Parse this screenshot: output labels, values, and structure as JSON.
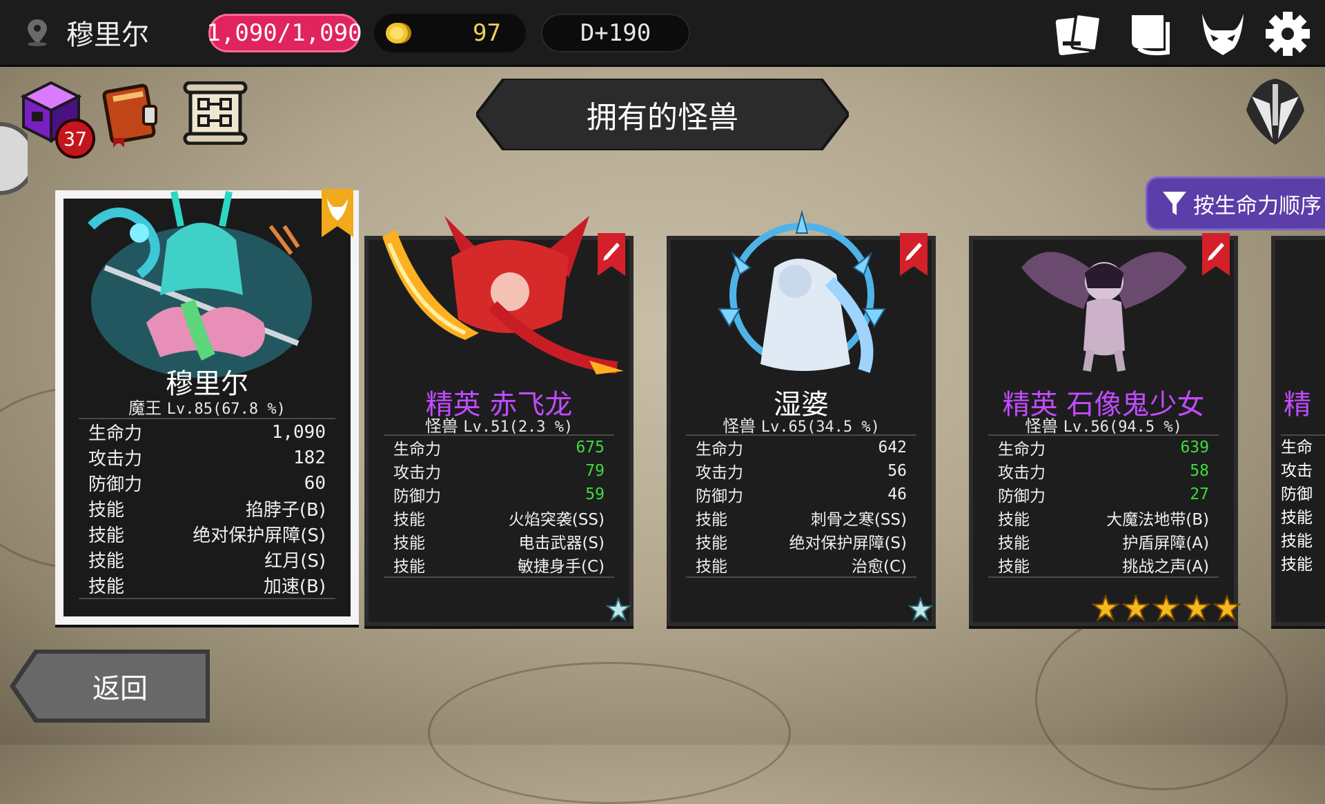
{
  "player": {
    "name": "穆里尔"
  },
  "resources": {
    "hp": "1,090/1,090",
    "coins": "97",
    "day": "D+190"
  },
  "cube_badge": "37",
  "title": "拥有的怪兽",
  "sort_label": "按生命力顺序",
  "back_label": "返回",
  "stat_labels": {
    "hp": "生命力",
    "atk": "攻击力",
    "def": "防御力",
    "skill": "技能"
  },
  "cards": [
    {
      "name": "穆里尔",
      "elite_prefix": "",
      "class": "魔王",
      "level": "Lv.85(67.8 %)",
      "hp": "1,090",
      "atk": "182",
      "def": "60",
      "skills": [
        "掐脖子(B)",
        "绝对保护屏障(S)",
        "红月(S)",
        "加速(B)"
      ],
      "bookmark": "demon-crest",
      "stars": 0,
      "color": "#f2a91c"
    },
    {
      "name": "赤飞龙",
      "elite_prefix": "精英",
      "class": "怪兽",
      "level": "Lv.51(2.3 %)",
      "hp": "675",
      "atk": "79",
      "def": "59",
      "skills": [
        "火焰突袭(SS)",
        "电击武器(S)",
        "敏捷身手(C)"
      ],
      "bookmark": "edit-pencil",
      "stars": 1
    },
    {
      "name": "湿婆",
      "elite_prefix": "",
      "class": "怪兽",
      "level": "Lv.65(34.5 %)",
      "hp": "642",
      "atk": "56",
      "def": "46",
      "skills": [
        "刺骨之寒(SS)",
        "绝对保护屏障(S)",
        "治愈(C)"
      ],
      "bookmark": "edit-pencil",
      "stars": 1
    },
    {
      "name": "石像鬼少女",
      "elite_prefix": "精英",
      "class": "怪兽",
      "level": "Lv.56(94.5 %)",
      "hp": "639",
      "atk": "58",
      "def": "27",
      "skills": [
        "大魔法地带(B)",
        "护盾屏障(A)",
        "挑战之声(A)"
      ],
      "bookmark": "edit-pencil",
      "stars": 5
    }
  ],
  "partial_card": {
    "name_fragment": "精",
    "labels": [
      "生命",
      "攻击",
      "防御",
      "技能",
      "技能",
      "技能"
    ]
  }
}
